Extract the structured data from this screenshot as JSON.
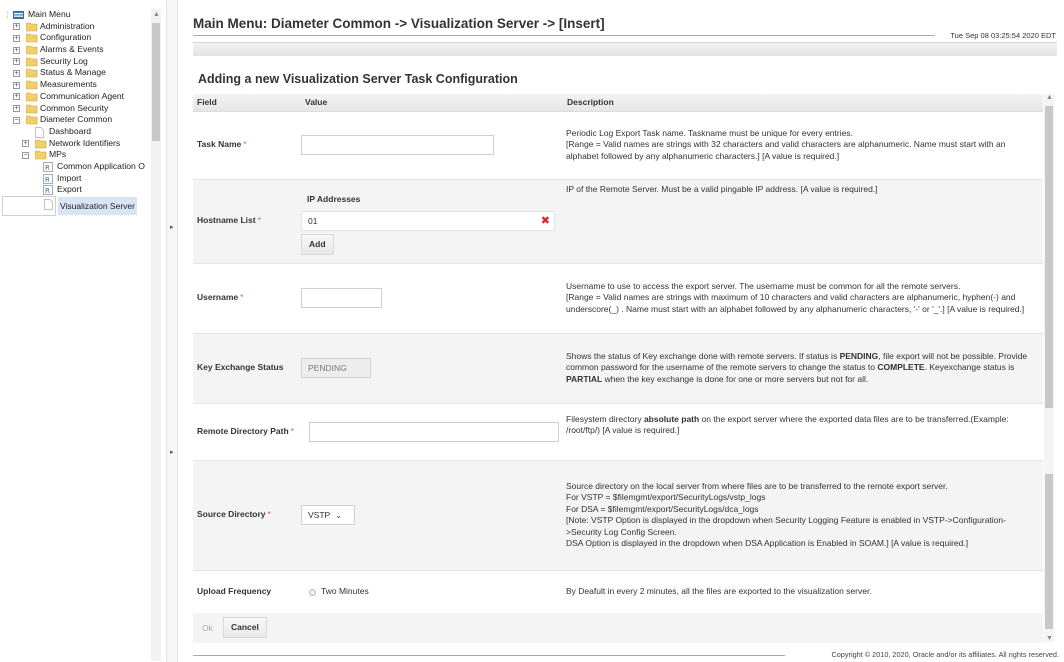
{
  "nav": {
    "root": "Main Menu",
    "items": [
      {
        "label": "Administration",
        "toggle": "+"
      },
      {
        "label": "Configuration",
        "toggle": "+"
      },
      {
        "label": "Alarms & Events",
        "toggle": "+"
      },
      {
        "label": "Security Log",
        "toggle": "+"
      },
      {
        "label": "Status & Manage",
        "toggle": "+"
      },
      {
        "label": "Measurements",
        "toggle": "+"
      },
      {
        "label": "Communication Agent",
        "toggle": "+"
      },
      {
        "label": "Common Security",
        "toggle": "+"
      },
      {
        "label": "Diameter Common",
        "toggle": "−"
      }
    ],
    "children": [
      {
        "label": "Dashboard"
      },
      {
        "label": "Network Identifiers",
        "toggle": "+"
      },
      {
        "label": "MPs",
        "toggle": "−"
      }
    ],
    "grandchildren": [
      {
        "label": "Common Application O"
      },
      {
        "label": "Import"
      },
      {
        "label": "Export"
      },
      {
        "label": "Visualization Server"
      }
    ]
  },
  "header": {
    "title": "Main Menu: Diameter Common -> Visualization Server -> [Insert]",
    "timestamp": "Tue Sep 08 03:25:54 2020 EDT"
  },
  "page": {
    "heading": "Adding a new Visualization Server Task Configuration"
  },
  "table": {
    "headers": {
      "field": "Field",
      "value": "Value",
      "description": "Description"
    },
    "required_mark": "*",
    "task_name": {
      "label": "Task Name",
      "desc1": "Periodic Log Export Task name. Taskname must be unique for every entries.",
      "desc2": "[Range = Valid names are strings with 32 characters and valid characters are alphanumeric. Name must start with an alphabet followed by any alphanumeric characters.] [A value is required.]"
    },
    "hostname": {
      "label": "Hostname List",
      "ip_header": "IP Addresses",
      "ip_value": "01",
      "add_label": "Add",
      "desc": "IP of the Remote Server. Must be a valid pingable IP address. [A value is required.]"
    },
    "username": {
      "label": "Username",
      "desc1": "Username to use to access the export server. The username must be common for all the remote servers.",
      "desc2": "[Range = Valid names are strings with maximum of 10 characters and valid characters are alphanumeric, hyphen(-) and underscore(_) . Name must start with an alphabet followed by any alphanumeric characters, '-' or '_'.] [A value is required.]"
    },
    "key_exchange": {
      "label": "Key Exchange Status",
      "value": "PENDING",
      "d1": "Shows the status of Key exchange done with remote servers. If status is ",
      "d1b": "PENDING",
      "d2": ", file export will not be possible. Provide common password for the username of the remote servers to change the status to ",
      "d2b": "COMPLETE",
      "d3": ". Keyexchange status is ",
      "d3b": "PARTIAL",
      "d4": " when the key exchange is done for one or more servers but not for all."
    },
    "remote_dir": {
      "label": "Remote Directory Path",
      "d1": "Filesystem directory ",
      "d1b": "absolute path",
      "d2": " on the export server where the exported data files are to be transferred.(Example: /root/ftp/) [A value is required.]"
    },
    "source_dir": {
      "label": "Source Directory",
      "value": "VSTP",
      "lines": [
        "Source directory on the local server from where files are to be transferred to the remote export server.",
        "For VSTP = $filemgmt/export/SecurityLogs/vstp_logs",
        "For DSA = $filemgmt/export/SecurityLogs/dca_logs",
        "[Note: VSTP Option is displayed in the dropdown when Security Logging Feature is enabled in VSTP->Configuration->Security Log Config Screen.",
        "DSA Option is displayed in the dropdown when DSA Application is Enabled in SOAM.] [A value is required.]"
      ]
    },
    "upload": {
      "label": "Upload Frequency",
      "option": "Two Minutes",
      "desc": "By Deafult in every 2 minutes, all the files are exported to the visualization server."
    }
  },
  "actions": {
    "ok": "Ok",
    "cancel": "Cancel"
  },
  "footer": {
    "copyright": "Copyright © 2010, 2020, Oracle and/or its affiliates. All rights reserved."
  },
  "colors": {
    "required": "#e05a5a",
    "remove": "#dd2222",
    "selected": "#d9e5f5"
  }
}
